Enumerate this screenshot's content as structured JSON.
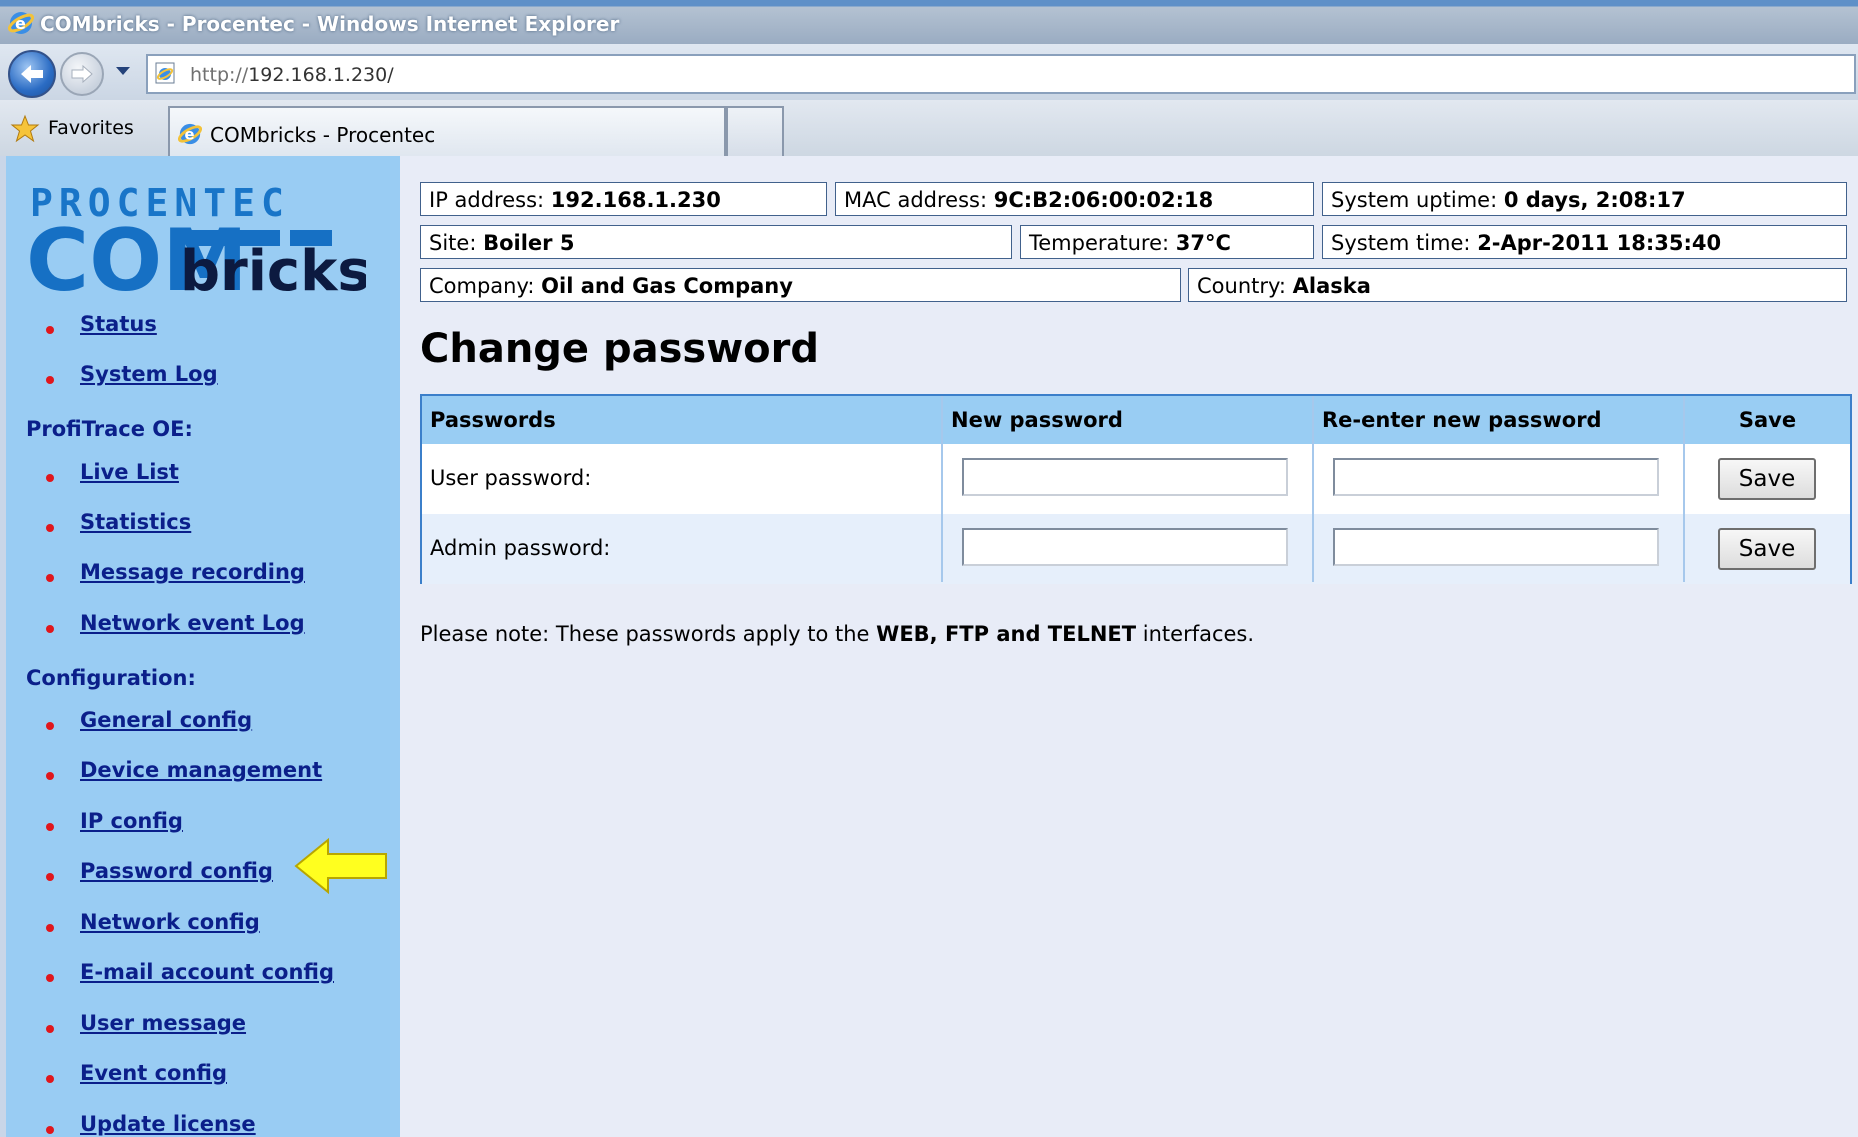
{
  "window": {
    "title": "COMbricks - Procentec - Windows Internet Explorer"
  },
  "addressbar": {
    "url_scheme": "http://",
    "url_rest": "192.168.1.230/"
  },
  "favorites_bar": {
    "favorites_label": "Favorites",
    "tab_title": "COMbricks - Procentec"
  },
  "logo": {
    "line1": "PROCENTEC",
    "line2a": "COM",
    "line2b": "bricks"
  },
  "sidebar": {
    "status": "Status",
    "system_log": "System Log",
    "profitrace_heading": "ProfiTrace OE:",
    "live_list": "Live List",
    "statistics": "Statistics",
    "message_recording": "Message recording",
    "network_event_log": "Network event Log",
    "configuration_heading": "Configuration:",
    "general_config": "General config",
    "device_management": "Device management",
    "ip_config": "IP config",
    "password_config": "Password config",
    "network_config": "Network config",
    "email_account_config": "E-mail account config",
    "user_message": "User message",
    "event_config": "Event config",
    "update_license": "Update license"
  },
  "info": {
    "ip_label": "IP address: ",
    "ip_value": "192.168.1.230",
    "mac_label": "MAC address: ",
    "mac_value": "9C:B2:06:00:02:18",
    "uptime_label": "System uptime: ",
    "uptime_value": "0 days, 2:08:17",
    "site_label": "Site: ",
    "site_value": "Boiler 5",
    "temp_label": "Temperature: ",
    "temp_value": "37°C",
    "time_label": "System time: ",
    "time_value": "2-Apr-2011 18:35:40",
    "company_label": "Company: ",
    "company_value": "Oil and Gas Company",
    "country_label": "Country: ",
    "country_value": "Alaska"
  },
  "main": {
    "heading": "Change password",
    "table": {
      "col_passwords": "Passwords",
      "col_new": "New password",
      "col_reenter": "Re-enter new password",
      "col_save": "Save",
      "row_user_label": "User password:",
      "row_admin_label": "Admin password:",
      "save_label": "Save",
      "user_new_value": "",
      "user_reenter_value": "",
      "admin_new_value": "",
      "admin_reenter_value": ""
    },
    "note_prefix": "Please note: These passwords apply to the ",
    "note_bold": "WEB, FTP and TELNET",
    "note_suffix": " interfaces."
  },
  "colors": {
    "sidebar_bg": "#99ccf3",
    "link": "#0b1f8a",
    "bullet": "#e0161c",
    "table_header": "#99cdf3",
    "page_bg": "#e8ecf7",
    "arrow": "#ffff1f"
  },
  "icons": [
    "ie-logo-icon",
    "back-arrow-icon",
    "forward-arrow-icon",
    "dropdown-arrow-icon",
    "page-icon",
    "favorites-star-icon",
    "highlight-arrow-icon"
  ]
}
